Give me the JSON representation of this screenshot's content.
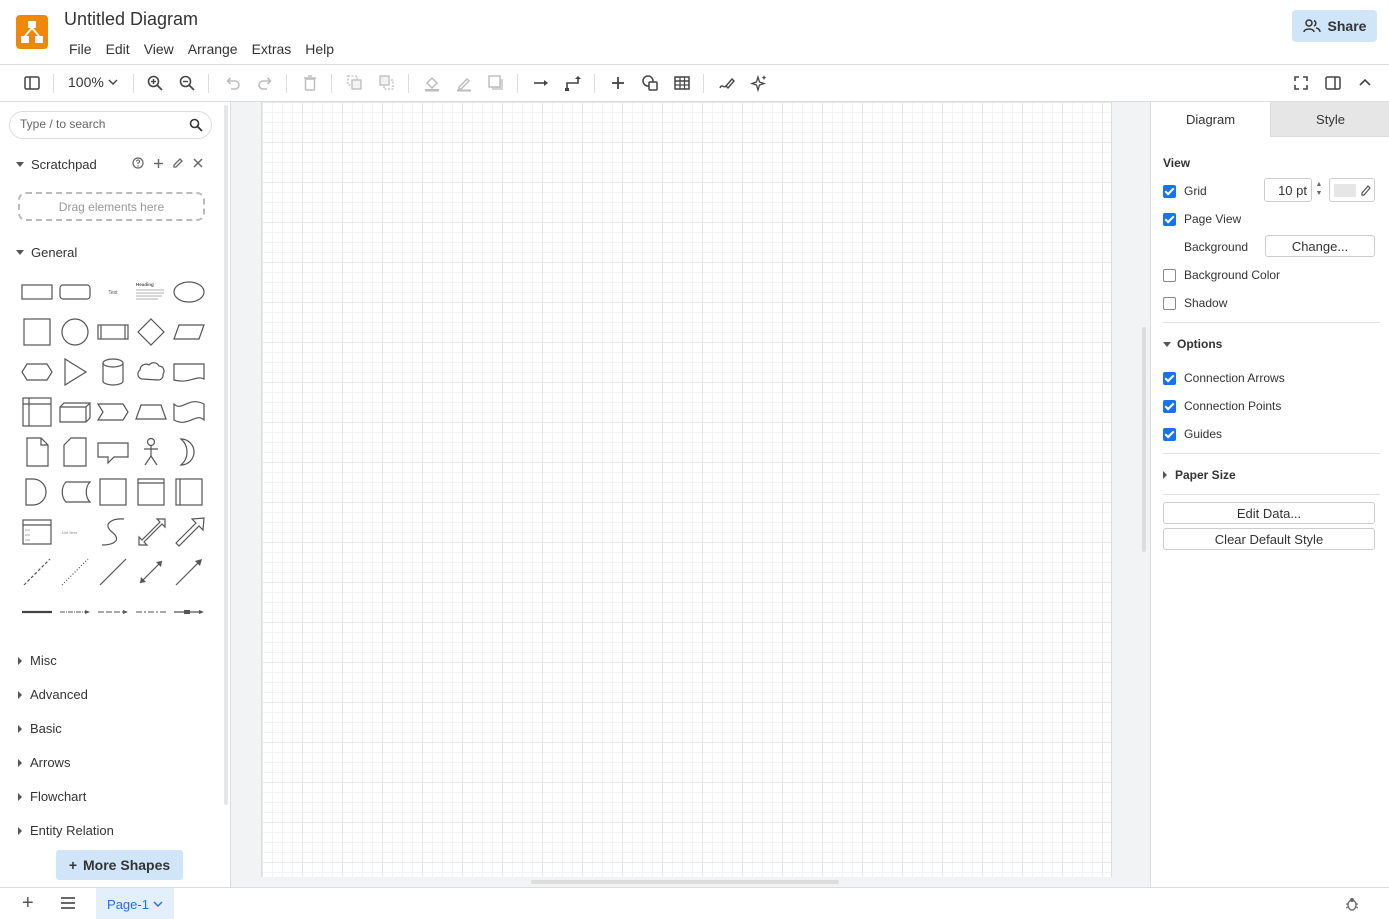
{
  "header": {
    "title": "Untitled Diagram",
    "menus": [
      "File",
      "Edit",
      "View",
      "Arrange",
      "Extras",
      "Help"
    ],
    "share_label": "Share"
  },
  "toolbar": {
    "zoom": "100%",
    "icons": [
      "sidebar-toggle-icon",
      "zoom-in-icon",
      "zoom-out-icon",
      "undo-icon",
      "redo-icon",
      "delete-icon",
      "to-front-icon",
      "to-back-icon",
      "fill-color-icon",
      "line-color-icon",
      "shadow-icon",
      "connection-icon",
      "waypoints-icon",
      "insert-icon",
      "shapes-icon",
      "table-icon",
      "freehand-icon",
      "ai-generate-icon",
      "fullscreen-icon",
      "format-panel-icon",
      "collapse-icon"
    ]
  },
  "sidebar": {
    "search_placeholder": "Type / to search",
    "scratchpad": {
      "title": "Scratchpad",
      "dropzone": "Drag elements here"
    },
    "general": {
      "title": "General",
      "shape_text_label": "Text",
      "shape_heading_label": "Heading",
      "shape_list_label": "List Item"
    },
    "collapsed_sections": [
      "Misc",
      "Advanced",
      "Basic",
      "Arrows",
      "Flowchart",
      "Entity Relation"
    ],
    "more_shapes": "More Shapes"
  },
  "format": {
    "tabs": [
      "Diagram",
      "Style"
    ],
    "view": {
      "heading": "View",
      "grid_label": "Grid",
      "grid_checked": true,
      "grid_size": "10 pt",
      "grid_color": "#e6e6e6",
      "page_view_label": "Page View",
      "page_view_checked": true,
      "background_label": "Background",
      "change_button": "Change...",
      "background_color_label": "Background Color",
      "background_color_checked": false,
      "shadow_label": "Shadow",
      "shadow_checked": false
    },
    "options": {
      "heading": "Options",
      "connection_arrows": "Connection Arrows",
      "connection_points": "Connection Points",
      "guides": "Guides"
    },
    "paper_size": "Paper Size",
    "edit_data": "Edit Data...",
    "clear_default_style": "Clear Default Style"
  },
  "footer": {
    "page_tab": "Page-1"
  },
  "colors": {
    "accent": "#1a73e8",
    "logo": "#f08705",
    "share_bg": "#d0e6f8"
  }
}
